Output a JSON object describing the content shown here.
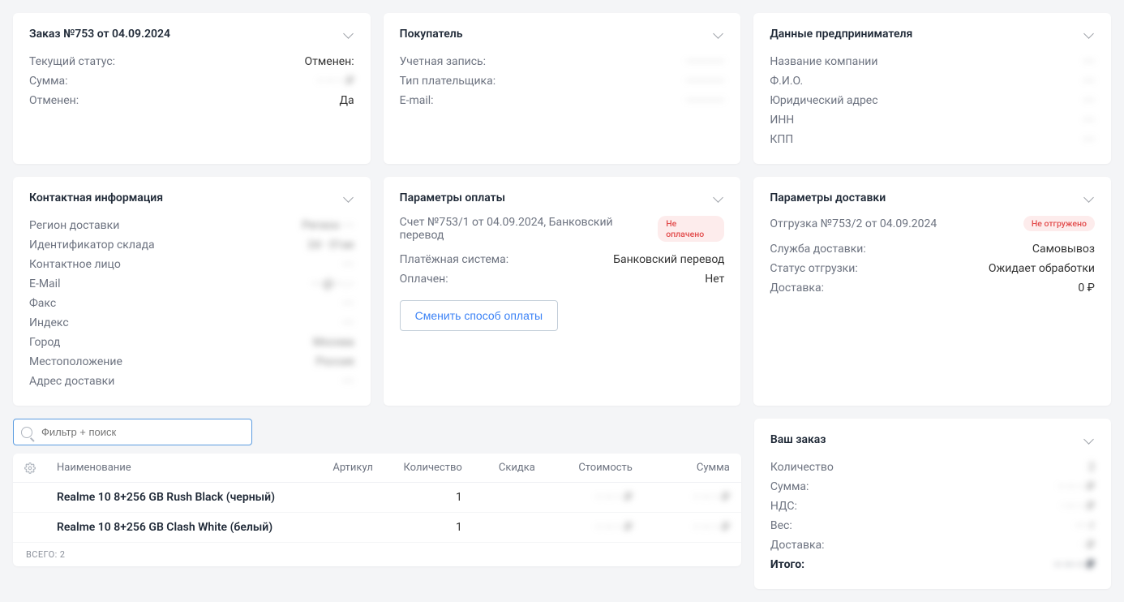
{
  "cards": {
    "order": {
      "title": "Заказ №753 от 04.09.2024",
      "rows": [
        {
          "label": "Текущий статус:",
          "value": "Отменен:"
        },
        {
          "label": "Сумма:",
          "value": "·· ··· ·· ₽",
          "blur": true
        },
        {
          "label": "Отменен:",
          "value": "Да"
        }
      ]
    },
    "buyer": {
      "title": "Покупатель",
      "rows": [
        {
          "label": "Учетная запись:",
          "value": "·············",
          "blur": true
        },
        {
          "label": "Тип плательщика:",
          "value": "·············",
          "blur": true
        },
        {
          "label": "E-mail:",
          "value": "·············",
          "blur": true
        }
      ]
    },
    "entrepreneur": {
      "title": "Данные предпринимателя",
      "rows": [
        {
          "label": "Название компании",
          "value": "····",
          "blur": true
        },
        {
          "label": "Ф.И.О.",
          "value": "····",
          "blur": true
        },
        {
          "label": "Юридический адрес",
          "value": "····",
          "blur": true
        },
        {
          "label": "ИНН",
          "value": "····",
          "blur": true
        },
        {
          "label": "КПП",
          "value": "····",
          "blur": true
        }
      ]
    },
    "contact": {
      "title": "Контактная информация",
      "rows": [
        {
          "label": "Регион доставки",
          "value": "Регион ····",
          "blur": true
        },
        {
          "label": "Идентификатор склада",
          "value": "2d···31ae",
          "blur": true
        },
        {
          "label": "Контактное лицо",
          "value": "····",
          "blur": true
        },
        {
          "label": "E-Mail",
          "value": "····@····.··",
          "blur": true
        },
        {
          "label": "Факс",
          "value": "····",
          "blur": true
        },
        {
          "label": "Индекс",
          "value": "····",
          "blur": true
        },
        {
          "label": "Город",
          "value": "Москва",
          "blur": true
        },
        {
          "label": "Местоположение",
          "value": "Россия",
          "blur": true
        },
        {
          "label": "Адрес доставки",
          "value": "····",
          "blur": true
        }
      ]
    },
    "payment": {
      "title": "Параметры оплаты",
      "subline": "Счет №753/1 от 04.09.2024, Банковский перевод",
      "badge": "Не оплачено",
      "rows": [
        {
          "label": "Платёжная система:",
          "value": "Банковский перевод"
        },
        {
          "label": "Оплачен:",
          "value": "Нет"
        }
      ],
      "button": "Сменить способ оплаты"
    },
    "shipping": {
      "title": "Параметры доставки",
      "subline": "Отгрузка №753/2 от 04.09.2024",
      "badge": "Не отгружено",
      "rows": [
        {
          "label": "Служба доставки:",
          "value": "Самовывоз"
        },
        {
          "label": "Статус отгрузки:",
          "value": "Ожидает обработки"
        },
        {
          "label": "Доставка:",
          "value": "0 ₽"
        }
      ]
    }
  },
  "search": {
    "placeholder": "Фильтр + поиск"
  },
  "table": {
    "headers": {
      "name": "Наименование",
      "sku": "Артикул",
      "qty": "Количество",
      "discount": "Скидка",
      "price": "Стоимость",
      "sum": "Сумма"
    },
    "rows": [
      {
        "name": "Realme 10 8+256 GB Rush Black (черный)",
        "sku": "",
        "qty": "1",
        "discount": "",
        "price": "·· ··· ·· ₽",
        "sum": "·· ··· ·· ₽"
      },
      {
        "name": "Realme 10 8+256 GB Clash White (белый)",
        "sku": "",
        "qty": "1",
        "discount": "",
        "price": "·· ··· ·· ₽",
        "sum": "·· ··· ·· ₽"
      }
    ],
    "footer_label": "ВСЕГО:",
    "footer_count": "2"
  },
  "summary": {
    "title": "Ваш заказ",
    "rows": [
      {
        "label": "Количество",
        "value": "2",
        "blur": true
      },
      {
        "label": "Сумма:",
        "value": "·· ··· ·· ₽",
        "blur": true
      },
      {
        "label": "НДС:",
        "value": "· ··· ·· ₽",
        "blur": true
      },
      {
        "label": "Вес:",
        "value": "···· г",
        "blur": true
      },
      {
        "label": "Доставка:",
        "value": "· ₽",
        "blur": true
      }
    ],
    "total": {
      "label": "Итого:",
      "value": "·· ··· ·· ₽",
      "blur": true
    }
  }
}
